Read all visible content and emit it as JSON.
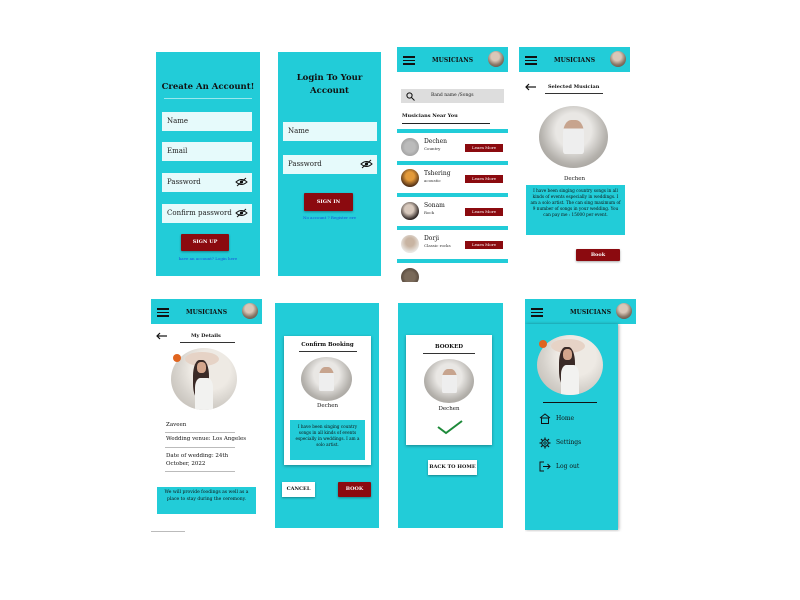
{
  "colors": {
    "accent": "#22ccd8",
    "button": "#8b0a0f",
    "field": "#e6fafb"
  },
  "create": {
    "title": "Create An Account!",
    "fields": [
      "Name",
      "Email",
      "Password",
      "Confirm password"
    ],
    "button": "SIGN UP",
    "link": "have an account? Login here"
  },
  "login": {
    "title": "Login To Your Account",
    "fields": [
      "Name",
      "Password"
    ],
    "button": "SIGN IN",
    "link": "No account ? Register ere"
  },
  "musicians_list": {
    "header": "MUSICIANS",
    "search_placeholder": "Band name /Songs",
    "section": "Musicians Near You",
    "learn": "Learn More",
    "items": [
      {
        "name": "Dechen",
        "genre": "Country"
      },
      {
        "name": "Tshering",
        "genre": "acoustic"
      },
      {
        "name": "Sonam",
        "genre": "Rock"
      },
      {
        "name": "Dorji",
        "genre": "Classic rocks"
      }
    ]
  },
  "selected": {
    "header": "MUSICIANS",
    "title": "Selected Musician",
    "name": "Dechen",
    "bio": "I have been singing country songs in all kinds of events especially in weddings. I am a solo artist. The can sing maximum of 9 number of songs in your wedding. You can pay me : 15000 per event.",
    "button": "Book"
  },
  "details": {
    "header": "MUSICIANS",
    "title": "My Details",
    "name": "Zaveen",
    "venue": "Wedding venue: Los Angeles",
    "date": "Date of wedding: 24th October, 2022",
    "note": "We will provide foodings as well as a place to stay during the ceremony."
  },
  "confirm": {
    "title": "Confirm Booking",
    "name": "Dechen",
    "bio": "I have been singing country songs in all kinds of events especially in weddings. I am a solo artist.",
    "cancel": "CANCEL",
    "book": "BOOK"
  },
  "booked": {
    "title": "BOOKED",
    "name": "Dechen",
    "back": "BACK TO HOME"
  },
  "menu": {
    "header": "MUSICIANS",
    "items": [
      "Home",
      "Settings",
      "Log out"
    ]
  }
}
